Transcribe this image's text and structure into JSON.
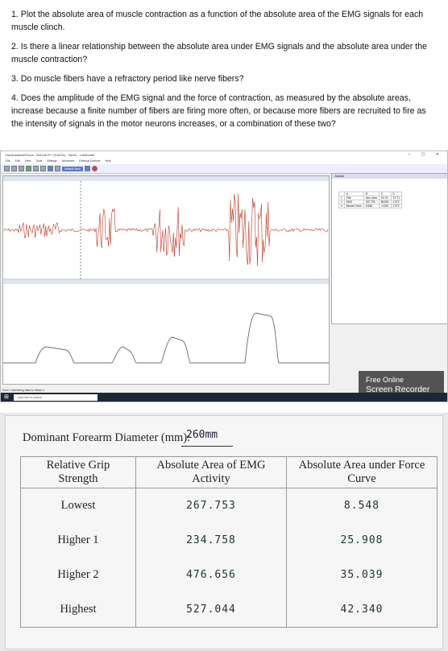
{
  "questions": [
    "1. Plot the absolute area of muscle contraction as a function of the absolute area of the EMG signals for each muscle clinch.",
    "2. Is there a linear relationship between the absolute area under EMG signals and the absolute area under the muscle contraction?",
    "3. Do muscle fibers have a refractory period like nerve fibers?",
    "4. Does the amplitude of the EMG signal and the force of contraction, as measured by the absolute areas, increase because a finite number of fibers are firing more often, or because more fibers are recruited to fire as the intensity of signals in the motor neurons increases, or a combination of these two?"
  ],
  "screenshot": {
    "window_title": "DominantArmForce - W3145 Fr+ (9-8201) - Never - LabScribe",
    "menu": [
      "File",
      "Edit",
      "View",
      "Tools",
      "Settings",
      "Advanced",
      "External Devices",
      "Help"
    ],
    "toolbar_label": "Default View",
    "status": "Done Calculating data for Block 4",
    "search_placeholder": "Type here to search",
    "recorder_line1": "Free Online",
    "recorder_line2": "Screen Recorder",
    "panel_title": "Journal",
    "panel_table": [
      [
        "",
        "A",
        "B",
        "C",
        "D"
      ],
      [
        "1",
        "Title",
        "Abs. Area",
        "V2-V1",
        "T2-T1"
      ],
      [
        "2",
        "EMG",
        "267.753",
        "85.852",
        "2.970"
      ],
      [
        "3",
        "Muscle Force",
        "8.548",
        "-0.026",
        "2.970"
      ]
    ],
    "colors": {
      "emg": "#c0392b",
      "force": "#444444",
      "accent": "#5a78c8"
    }
  },
  "worksheet": {
    "diameter_label": "Dominant Forearm Diameter (mm):",
    "diameter_value": "260mm",
    "headers": [
      "Relative Grip Strength",
      "Absolute Area of EMG Activity",
      "Absolute Area under Force Curve"
    ],
    "rows": [
      {
        "strength": "Lowest",
        "emg": "267.753",
        "force": "8.548"
      },
      {
        "strength": "Higher 1",
        "emg": "234.758",
        "force": "25.908"
      },
      {
        "strength": "Higher 2",
        "emg": "476.656",
        "force": "35.039"
      },
      {
        "strength": "Highest",
        "emg": "527.044",
        "force": "42.340"
      }
    ]
  }
}
